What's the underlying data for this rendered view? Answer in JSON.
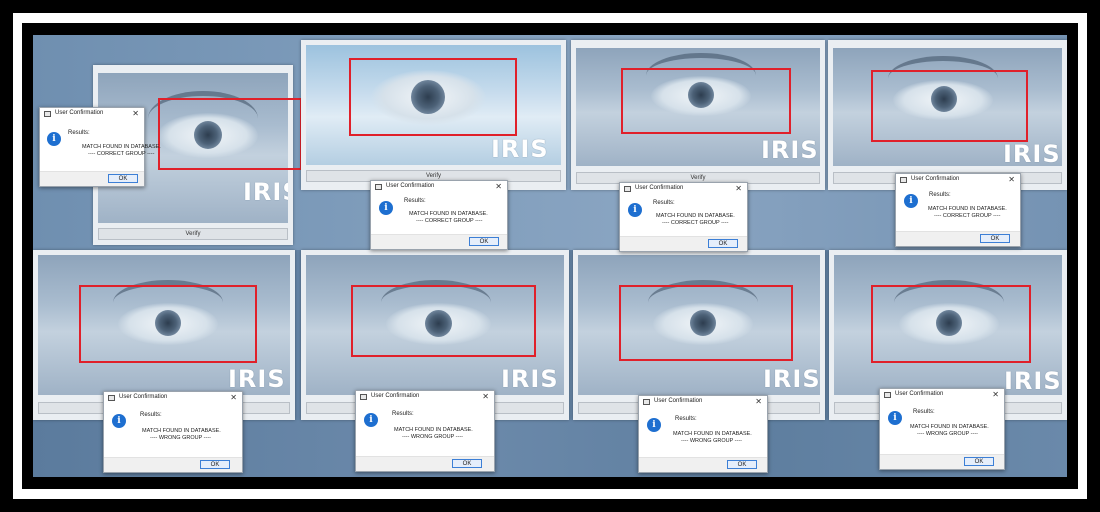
{
  "dialog": {
    "title": "User Confirmation",
    "heading": "Results:",
    "message": "MATCH FOUND IN DATABASE.",
    "ok_label": "OK"
  },
  "panels": {
    "iris_label": "IRIS",
    "verify_label": "Verify"
  },
  "groups": {
    "correct": "---- CORRECT GROUP ----",
    "wrong": "---- WRONG GROUP ----"
  },
  "icons": {
    "info": "info-icon",
    "close": "close-icon",
    "app": "window-icon"
  },
  "colors": {
    "roi_box": "#e0202a",
    "info_icon": "#1e6fd0",
    "background": "#5f7fa0"
  }
}
